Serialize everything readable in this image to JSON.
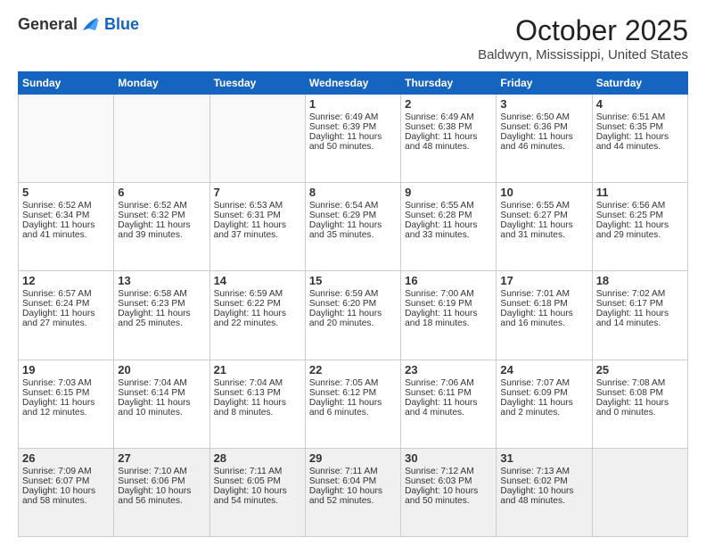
{
  "header": {
    "logo_general": "General",
    "logo_blue": "Blue",
    "title": "October 2025",
    "subtitle": "Baldwyn, Mississippi, United States"
  },
  "weekdays": [
    "Sunday",
    "Monday",
    "Tuesday",
    "Wednesday",
    "Thursday",
    "Friday",
    "Saturday"
  ],
  "weeks": [
    [
      {
        "day": "",
        "info": ""
      },
      {
        "day": "",
        "info": ""
      },
      {
        "day": "",
        "info": ""
      },
      {
        "day": "1",
        "info": "Sunrise: 6:49 AM\nSunset: 6:39 PM\nDaylight: 11 hours\nand 50 minutes."
      },
      {
        "day": "2",
        "info": "Sunrise: 6:49 AM\nSunset: 6:38 PM\nDaylight: 11 hours\nand 48 minutes."
      },
      {
        "day": "3",
        "info": "Sunrise: 6:50 AM\nSunset: 6:36 PM\nDaylight: 11 hours\nand 46 minutes."
      },
      {
        "day": "4",
        "info": "Sunrise: 6:51 AM\nSunset: 6:35 PM\nDaylight: 11 hours\nand 44 minutes."
      }
    ],
    [
      {
        "day": "5",
        "info": "Sunrise: 6:52 AM\nSunset: 6:34 PM\nDaylight: 11 hours\nand 41 minutes."
      },
      {
        "day": "6",
        "info": "Sunrise: 6:52 AM\nSunset: 6:32 PM\nDaylight: 11 hours\nand 39 minutes."
      },
      {
        "day": "7",
        "info": "Sunrise: 6:53 AM\nSunset: 6:31 PM\nDaylight: 11 hours\nand 37 minutes."
      },
      {
        "day": "8",
        "info": "Sunrise: 6:54 AM\nSunset: 6:29 PM\nDaylight: 11 hours\nand 35 minutes."
      },
      {
        "day": "9",
        "info": "Sunrise: 6:55 AM\nSunset: 6:28 PM\nDaylight: 11 hours\nand 33 minutes."
      },
      {
        "day": "10",
        "info": "Sunrise: 6:55 AM\nSunset: 6:27 PM\nDaylight: 11 hours\nand 31 minutes."
      },
      {
        "day": "11",
        "info": "Sunrise: 6:56 AM\nSunset: 6:25 PM\nDaylight: 11 hours\nand 29 minutes."
      }
    ],
    [
      {
        "day": "12",
        "info": "Sunrise: 6:57 AM\nSunset: 6:24 PM\nDaylight: 11 hours\nand 27 minutes."
      },
      {
        "day": "13",
        "info": "Sunrise: 6:58 AM\nSunset: 6:23 PM\nDaylight: 11 hours\nand 25 minutes."
      },
      {
        "day": "14",
        "info": "Sunrise: 6:59 AM\nSunset: 6:22 PM\nDaylight: 11 hours\nand 22 minutes."
      },
      {
        "day": "15",
        "info": "Sunrise: 6:59 AM\nSunset: 6:20 PM\nDaylight: 11 hours\nand 20 minutes."
      },
      {
        "day": "16",
        "info": "Sunrise: 7:00 AM\nSunset: 6:19 PM\nDaylight: 11 hours\nand 18 minutes."
      },
      {
        "day": "17",
        "info": "Sunrise: 7:01 AM\nSunset: 6:18 PM\nDaylight: 11 hours\nand 16 minutes."
      },
      {
        "day": "18",
        "info": "Sunrise: 7:02 AM\nSunset: 6:17 PM\nDaylight: 11 hours\nand 14 minutes."
      }
    ],
    [
      {
        "day": "19",
        "info": "Sunrise: 7:03 AM\nSunset: 6:15 PM\nDaylight: 11 hours\nand 12 minutes."
      },
      {
        "day": "20",
        "info": "Sunrise: 7:04 AM\nSunset: 6:14 PM\nDaylight: 11 hours\nand 10 minutes."
      },
      {
        "day": "21",
        "info": "Sunrise: 7:04 AM\nSunset: 6:13 PM\nDaylight: 11 hours\nand 8 minutes."
      },
      {
        "day": "22",
        "info": "Sunrise: 7:05 AM\nSunset: 6:12 PM\nDaylight: 11 hours\nand 6 minutes."
      },
      {
        "day": "23",
        "info": "Sunrise: 7:06 AM\nSunset: 6:11 PM\nDaylight: 11 hours\nand 4 minutes."
      },
      {
        "day": "24",
        "info": "Sunrise: 7:07 AM\nSunset: 6:09 PM\nDaylight: 11 hours\nand 2 minutes."
      },
      {
        "day": "25",
        "info": "Sunrise: 7:08 AM\nSunset: 6:08 PM\nDaylight: 11 hours\nand 0 minutes."
      }
    ],
    [
      {
        "day": "26",
        "info": "Sunrise: 7:09 AM\nSunset: 6:07 PM\nDaylight: 10 hours\nand 58 minutes."
      },
      {
        "day": "27",
        "info": "Sunrise: 7:10 AM\nSunset: 6:06 PM\nDaylight: 10 hours\nand 56 minutes."
      },
      {
        "day": "28",
        "info": "Sunrise: 7:11 AM\nSunset: 6:05 PM\nDaylight: 10 hours\nand 54 minutes."
      },
      {
        "day": "29",
        "info": "Sunrise: 7:11 AM\nSunset: 6:04 PM\nDaylight: 10 hours\nand 52 minutes."
      },
      {
        "day": "30",
        "info": "Sunrise: 7:12 AM\nSunset: 6:03 PM\nDaylight: 10 hours\nand 50 minutes."
      },
      {
        "day": "31",
        "info": "Sunrise: 7:13 AM\nSunset: 6:02 PM\nDaylight: 10 hours\nand 48 minutes."
      },
      {
        "day": "",
        "info": ""
      }
    ]
  ]
}
